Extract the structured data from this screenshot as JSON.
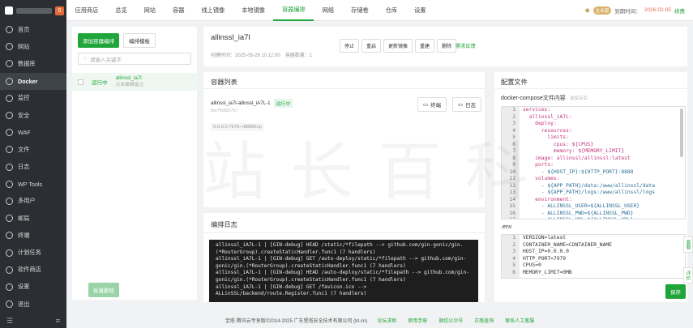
{
  "sidebar": {
    "badge": "0",
    "items": [
      {
        "label": "首页",
        "icon": "home-icon"
      },
      {
        "label": "网站",
        "icon": "globe-icon"
      },
      {
        "label": "数据库",
        "icon": "database-icon"
      },
      {
        "label": "Docker",
        "icon": "docker-icon"
      },
      {
        "label": "监控",
        "icon": "monitor-icon"
      },
      {
        "label": "安全",
        "icon": "shield-icon"
      },
      {
        "label": "WAF",
        "icon": "waf-icon"
      },
      {
        "label": "文件",
        "icon": "folder-icon"
      },
      {
        "label": "日志",
        "icon": "log-icon"
      },
      {
        "label": "WP Tools",
        "icon": "wordpress-icon"
      },
      {
        "label": "多用户",
        "icon": "users-icon"
      },
      {
        "label": "邮局",
        "icon": "mail-icon"
      },
      {
        "label": "终端",
        "icon": "terminal-icon"
      },
      {
        "label": "计划任务",
        "icon": "clock-icon"
      },
      {
        "label": "软件商店",
        "icon": "store-icon"
      },
      {
        "label": "设置",
        "icon": "gear-icon"
      },
      {
        "label": "退出",
        "icon": "logout-icon"
      }
    ],
    "active_index": 3
  },
  "topbar": {
    "tabs": [
      "应用商店",
      "总览",
      "网站",
      "容器",
      "线上镜像",
      "本地镜像",
      "容器编排",
      "网络",
      "存储卷",
      "仓库",
      "设置"
    ],
    "active_index": 6,
    "vip_label": "企业版",
    "expire_label": "到期时间：",
    "expire_date": "2026-02-05",
    "renew_label": "续费"
  },
  "compose_list": {
    "add_button": "添加容器编排",
    "template_button": "编排模板",
    "search_placeholder": "请输入关键字",
    "items": [
      {
        "status": "运行中",
        "name": "allinssl_ia7l",
        "desc": "点击编辑备注"
      }
    ],
    "batch_delete": "批量删除"
  },
  "compose_header": {
    "title": "allinssl_ia7l",
    "created_label": "创建时间：2025-05-28 10:12:00",
    "count_label": "容器数量：1",
    "actions": [
      "停止",
      "重启",
      "更新镜像",
      "重建",
      "删除"
    ],
    "feedback": "需求反馈"
  },
  "container_list": {
    "title": "容器列表",
    "container_name": "allinssl_ia7l-allinssl_iA7L-1",
    "status": "运行中",
    "image": "fbe7f08b57b7",
    "ports": "0.0.0.0:7979->8888/tcp",
    "terminal_btn": "终端",
    "log_btn": "日志"
  },
  "compose_log": {
    "title": "编排日志",
    "lines": [
      "allinssl_iA7L-1 | [GIN-debug] HEAD /static/*filepath --> github.com/gin-gonic/gin.",
      "(*RouterGroup).createStaticHandler.func1 (7 handlers)",
      "allinssl_iA7L-1 | [GIN-debug] GET /auto-deploy/static/*filepath --> github.com/gin-",
      "gonic/gin.(*RouterGroup).createStaticHandler.func1 (7 handlers)",
      "allinssl_iA7L-1 | [GIN-debug] HEAD /auto-deploy/static/*filepath --> github.com/gin-",
      "gonic/gin.(*RouterGroup).createStaticHandler.func1 (7 handlers)",
      "allinssl_iA7L-1 | [GIN-debug] GET /favicon.ico -->",
      "ALLinSSL/backend/route.Register.func1 (7 handlers)"
    ]
  },
  "config": {
    "title": "配置文件",
    "compose_label": "docker-compose文件内容",
    "compose_hint": "请保存后",
    "compose_lines": [
      "services:",
      "  allinssl_iA7L:",
      "    deploy:",
      "      resources:",
      "        limits:",
      "          cpus: ${CPUS}",
      "          memory: ${MEMORY_LIMIT}",
      "    image: allinssl/allinssl:latest",
      "    ports:",
      "      - ${HOST_IP}:${HTTP_PORT}:8888",
      "    volumes:",
      "      - ${APP_PATH}/data:/www/allinssl/data",
      "      - ${APP_PATH}/logs:/www/allinssl/logs",
      "    environment:",
      "      - ALLINSSL_USER=${ALLINSSL_USER}",
      "      - ALLINSSL_PWD=${ALLINSSL_PWD}",
      "      - ALLINSSL_URL=${ALLINSSL_URL}"
    ],
    "env_label": ".env",
    "env_lines": [
      "VERSION=latest",
      "CONTAINER_NAME=CONTAINER_NAME",
      "HOST_IP=0.0.0.0",
      "HTTP_PORT=7979",
      "CPUS=0",
      "MEMORY_LIMIT=0MB"
    ],
    "save_button": "保存"
  },
  "footer": {
    "copyright": "宝塔·腾讯云专享版©2014-2025 广东堡塔安全技术有限公司 (bt.cn)",
    "links": [
      "论坛求助",
      "使用手册",
      "微信公众号",
      "正版查询",
      "联系人工客服"
    ]
  },
  "float_tabs": [
    "客服",
    "评价"
  ],
  "watermark": "站长百科",
  "colors": {
    "accent": "#20a53a",
    "sidebar": "#2b2f33",
    "terminal": "#1e1e1e"
  }
}
